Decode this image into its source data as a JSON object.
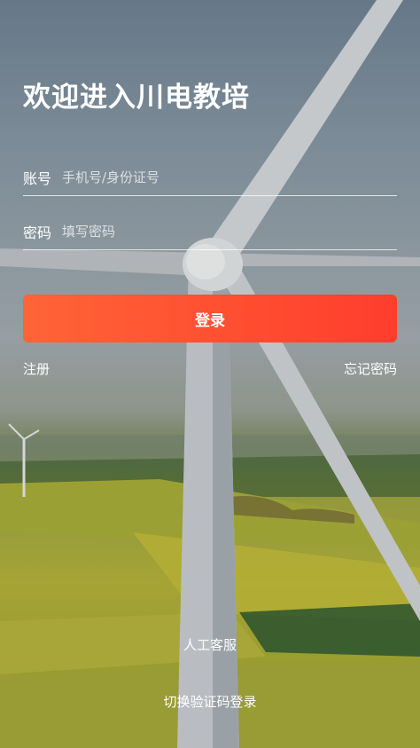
{
  "header": {
    "title": "欢迎进入川电教培"
  },
  "form": {
    "account": {
      "label": "账号",
      "placeholder": "手机号/身份证号",
      "value": ""
    },
    "password": {
      "label": "密码",
      "placeholder": "填写密码",
      "value": ""
    }
  },
  "actions": {
    "login_label": "登录",
    "register_label": "注册",
    "forgot_label": "忘记密码",
    "customer_service_label": "人工客服",
    "switch_login_label": "切换验证码登录"
  },
  "colors": {
    "login_gradient_start": "#ff6436",
    "login_gradient_end": "#ff3d2d",
    "text": "#ffffff"
  },
  "background": {
    "scene": "wind-turbine-over-rapeseed-fields"
  }
}
